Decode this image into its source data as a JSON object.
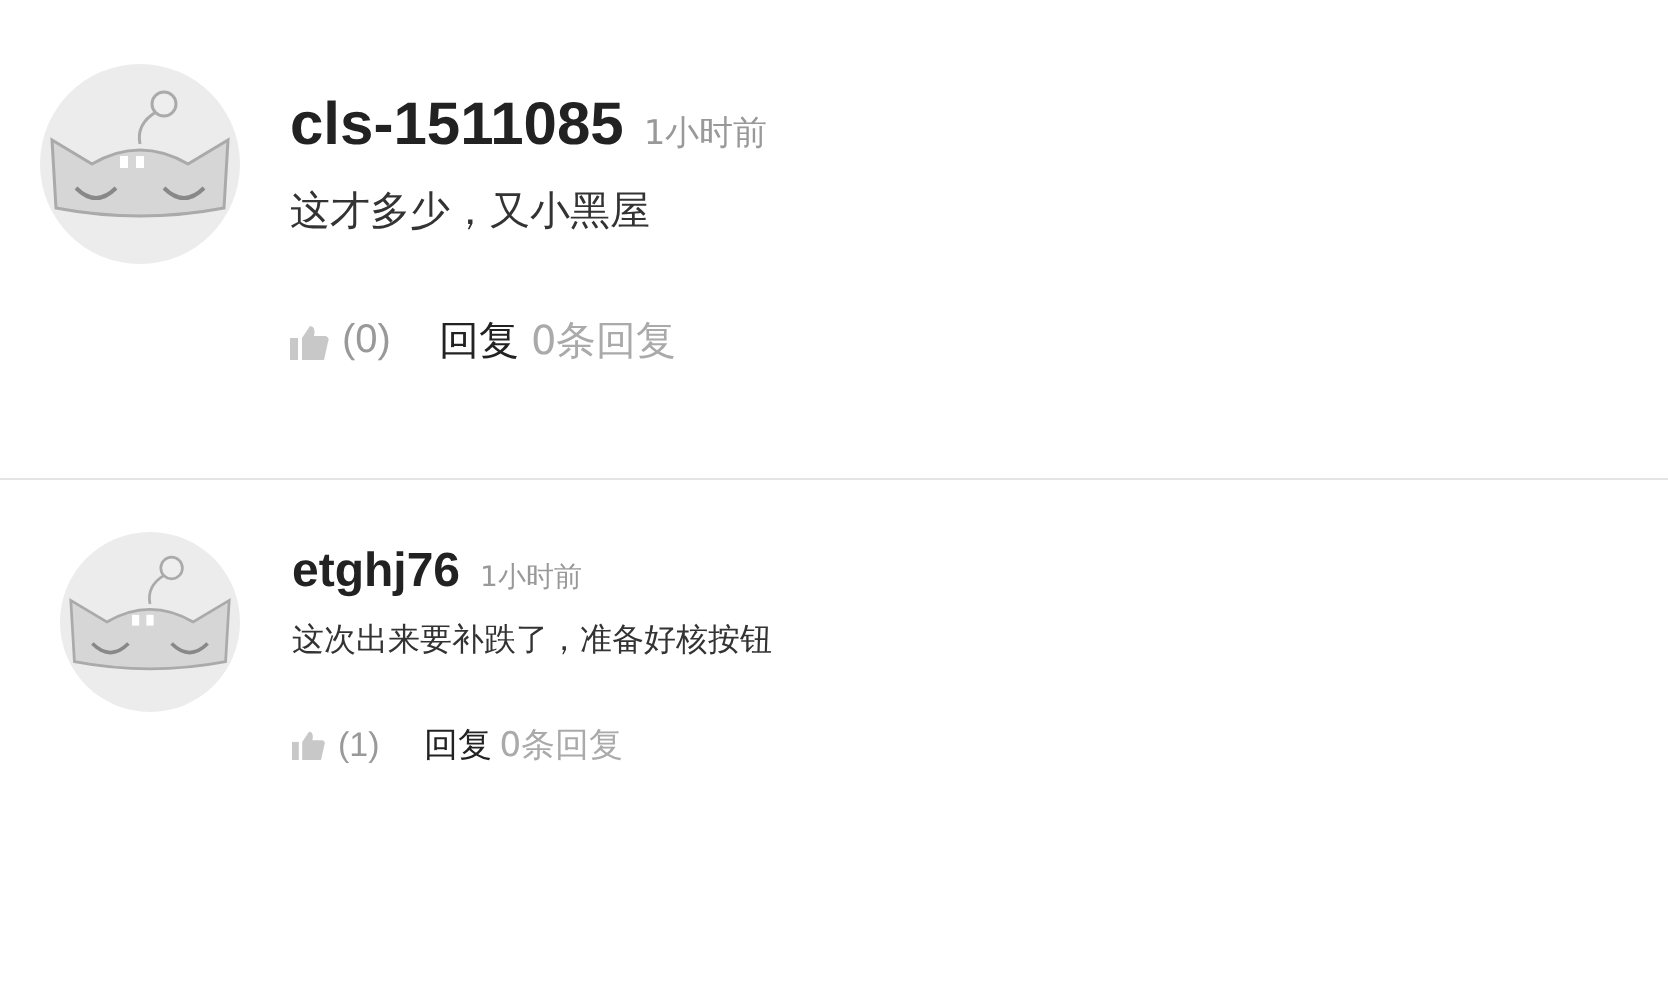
{
  "comments": [
    {
      "user": "cls-1511085",
      "time": "1小时前",
      "text": "这才多少，又小黑屋",
      "likes": "(0)",
      "reply": "回复",
      "replies": "0条回复"
    },
    {
      "user": "etghj76",
      "time": "1小时前",
      "text": "这次出来要补跌了，准备好核按钮",
      "likes": "(1)",
      "reply": "回复",
      "replies": "0条回复"
    }
  ]
}
